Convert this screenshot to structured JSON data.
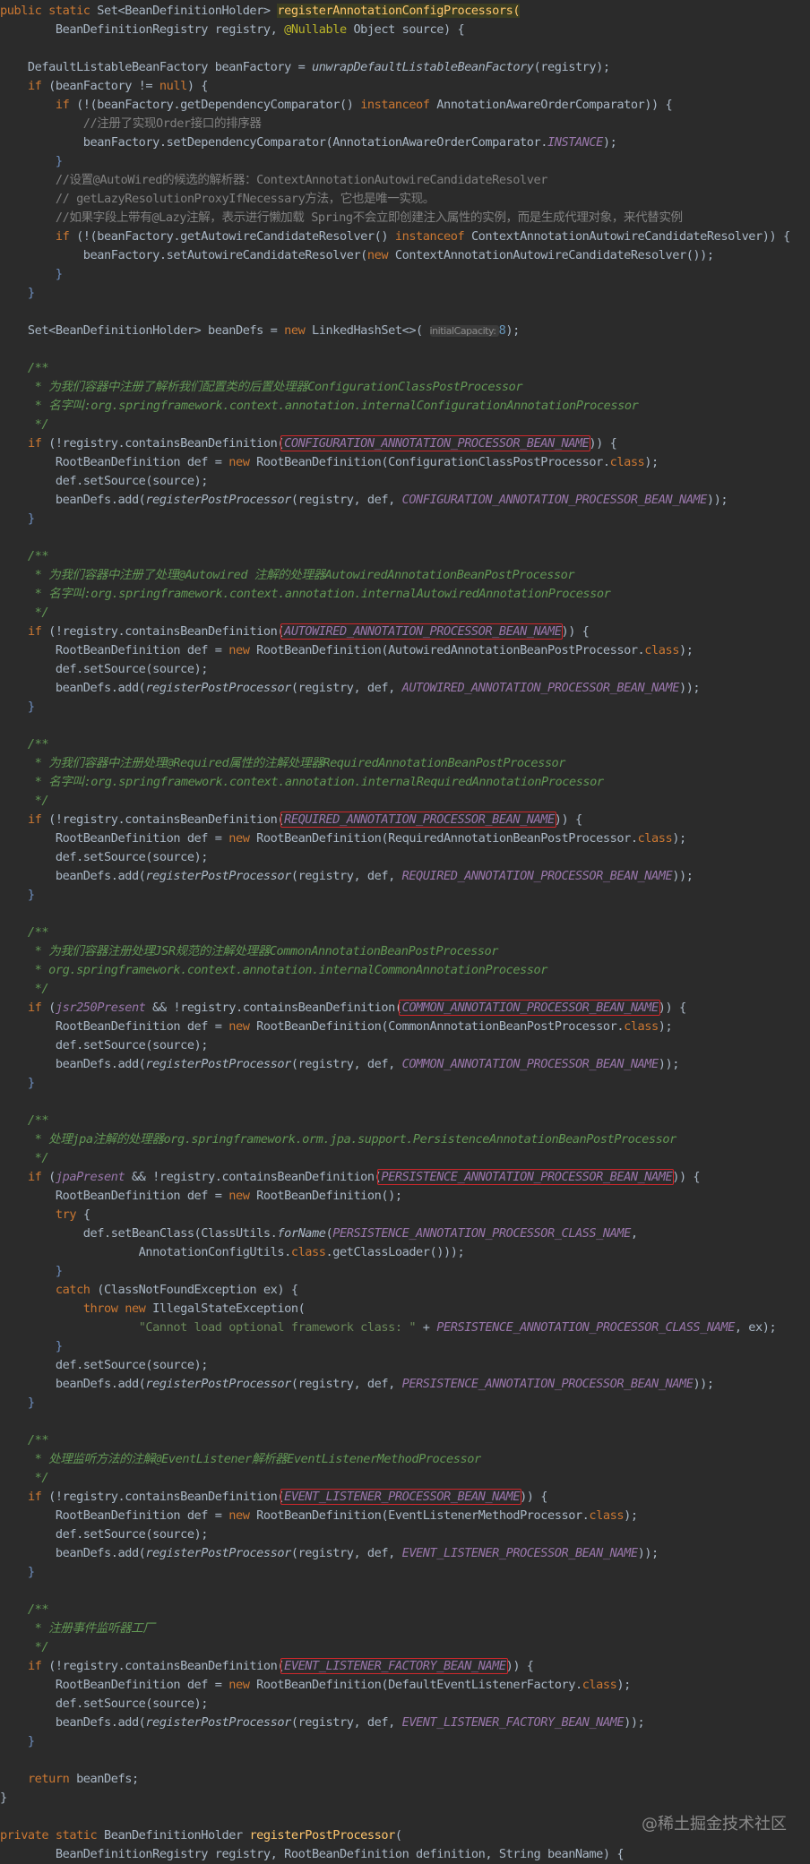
{
  "theme": {
    "bg": "#2b2b2b",
    "text": "#a9b7c6",
    "keyword": "#cc7832",
    "method": "#ffc66d",
    "call": "#a9b7c6",
    "comment": "#808080",
    "doc": "#629755",
    "constant": "#9876aa",
    "number": "#6897bb",
    "string": "#6a8759",
    "annotation": "#bbb529",
    "brace": "#6e8fc0",
    "hint": "#8c8c8c",
    "hint_bg": "#3b3b3b",
    "box": "#d0282c",
    "method_hl_bg": "#3b3d22"
  },
  "code_lines": [
    [
      [
        "public static ",
        "kw"
      ],
      [
        "Set<BeanDefinitionHolder> ",
        "tx"
      ],
      [
        "registerAnnotationConfigProcessors(",
        "mh"
      ]
    ],
    [
      [
        "        BeanDefinitionRegistry registry, ",
        "tx"
      ],
      [
        "@Nullable ",
        "an"
      ],
      [
        "Object source) {",
        "tx"
      ]
    ],
    [],
    [
      [
        "    DefaultListableBeanFactory beanFactory = ",
        "tx"
      ],
      [
        "unwrapDefaultListableBeanFactory",
        "it"
      ],
      [
        "(registry);",
        "tx"
      ]
    ],
    [
      [
        "    ",
        "tx"
      ],
      [
        "if ",
        "kw"
      ],
      [
        "(beanFactory != ",
        "tx"
      ],
      [
        "null",
        "kw"
      ],
      [
        ") {",
        "tx"
      ]
    ],
    [
      [
        "        ",
        "tx"
      ],
      [
        "if ",
        "kw"
      ],
      [
        "(!(beanFactory.getDependencyComparator() ",
        "tx"
      ],
      [
        "instanceof ",
        "kw"
      ],
      [
        "AnnotationAwareOrderComparator)) {",
        "tx"
      ]
    ],
    [
      [
        "            //注册了实现Order接口的排序器",
        "cm"
      ]
    ],
    [
      [
        "            beanFactory.setDependencyComparator(AnnotationAwareOrderComparator.",
        "tx"
      ],
      [
        "INSTANCE",
        "co"
      ],
      [
        ");",
        "tx"
      ]
    ],
    [
      [
        "        }",
        "br"
      ]
    ],
    [
      [
        "        //设置@AutoWired的候选的解析器：ContextAnnotationAutowireCandidateResolver",
        "cm"
      ]
    ],
    [
      [
        "        // getLazyResolutionProxyIfNecessary方法，它也是唯一实现。",
        "cm"
      ]
    ],
    [
      [
        "        //如果字段上带有@Lazy注解，表示进行懒加载 Spring不会立即创建注入属性的实例，而是生成代理对象，来代替实例",
        "cm"
      ]
    ],
    [
      [
        "        ",
        "tx"
      ],
      [
        "if ",
        "kw"
      ],
      [
        "(!(beanFactory.getAutowireCandidateResolver() ",
        "tx"
      ],
      [
        "instanceof ",
        "kw"
      ],
      [
        "ContextAnnotationAutowireCandidateResolver)) {",
        "tx"
      ]
    ],
    [
      [
        "            beanFactory.setAutowireCandidateResolver(",
        "tx"
      ],
      [
        "new ",
        "kw"
      ],
      [
        "ContextAnnotationAutowireCandidateResolver());",
        "tx"
      ]
    ],
    [
      [
        "        }",
        "br"
      ]
    ],
    [
      [
        "    }",
        "br"
      ]
    ],
    [],
    [
      [
        "    Set<BeanDefinitionHolder> beanDefs = ",
        "tx"
      ],
      [
        "new ",
        "kw"
      ],
      [
        "LinkedHashSet<>( ",
        "tx"
      ],
      [
        "initialCapacity: ",
        "hint"
      ],
      [
        "8",
        "nm"
      ],
      [
        ");",
        "tx"
      ]
    ],
    [],
    [
      [
        "    /**",
        "dc"
      ]
    ],
    [
      [
        "     * 为我们容器中注册了解析我们配置类的后置处理器ConfigurationClassPostProcessor",
        "dc"
      ]
    ],
    [
      [
        "     * 名字叫:org.springframework.context.annotation.internalConfigurationAnnotationProcessor",
        "dc"
      ]
    ],
    [
      [
        "     */",
        "dc"
      ]
    ],
    [
      [
        "    ",
        "tx"
      ],
      [
        "if ",
        "kw"
      ],
      [
        "(!registry.containsBeanDefinition(",
        "tx"
      ],
      [
        "CONFIGURATION_ANNOTATION_PROCESSOR_BEAN_NAME",
        "co"
      ],
      [
        ")) {",
        "tx"
      ]
    ],
    [
      [
        "        RootBeanDefinition def = ",
        "tx"
      ],
      [
        "new ",
        "kw"
      ],
      [
        "RootBeanDefinition(ConfigurationClassPostProcessor.",
        "tx"
      ],
      [
        "class",
        "kw"
      ],
      [
        ");",
        "tx"
      ]
    ],
    [
      [
        "        def.setSource(source);",
        "tx"
      ]
    ],
    [
      [
        "        beanDefs.add(",
        "tx"
      ],
      [
        "registerPostProcessor",
        "it"
      ],
      [
        "(registry, def, ",
        "tx"
      ],
      [
        "CONFIGURATION_ANNOTATION_PROCESSOR_BEAN_NAME",
        "co"
      ],
      [
        "));",
        "tx"
      ]
    ],
    [
      [
        "    }",
        "br"
      ]
    ],
    [],
    [
      [
        "    /**",
        "dc"
      ]
    ],
    [
      [
        "     * 为我们容器中注册了处理@Autowired 注解的处理器AutowiredAnnotationBeanPostProcessor",
        "dc"
      ]
    ],
    [
      [
        "     * 名字叫:org.springframework.context.annotation.internalAutowiredAnnotationProcessor",
        "dc"
      ]
    ],
    [
      [
        "     */",
        "dc"
      ]
    ],
    [
      [
        "    ",
        "tx"
      ],
      [
        "if ",
        "kw"
      ],
      [
        "(!registry.containsBeanDefinition(",
        "tx"
      ],
      [
        "AUTOWIRED_ANNOTATION_PROCESSOR_BEAN_NAME",
        "co"
      ],
      [
        ")) {",
        "tx"
      ]
    ],
    [
      [
        "        RootBeanDefinition def = ",
        "tx"
      ],
      [
        "new ",
        "kw"
      ],
      [
        "RootBeanDefinition(AutowiredAnnotationBeanPostProcessor.",
        "tx"
      ],
      [
        "class",
        "kw"
      ],
      [
        ");",
        "tx"
      ]
    ],
    [
      [
        "        def.setSource(source);",
        "tx"
      ]
    ],
    [
      [
        "        beanDefs.add(",
        "tx"
      ],
      [
        "registerPostProcessor",
        "it"
      ],
      [
        "(registry, def, ",
        "tx"
      ],
      [
        "AUTOWIRED_ANNOTATION_PROCESSOR_BEAN_NAME",
        "co"
      ],
      [
        "));",
        "tx"
      ]
    ],
    [
      [
        "    }",
        "br"
      ]
    ],
    [],
    [
      [
        "    /**",
        "dc"
      ]
    ],
    [
      [
        "     * 为我们容器中注册处理@Required属性的注解处理器RequiredAnnotationBeanPostProcessor",
        "dc"
      ]
    ],
    [
      [
        "     * 名字叫:org.springframework.context.annotation.internalRequiredAnnotationProcessor",
        "dc"
      ]
    ],
    [
      [
        "     */",
        "dc"
      ]
    ],
    [
      [
        "    ",
        "tx"
      ],
      [
        "if ",
        "kw"
      ],
      [
        "(!registry.containsBeanDefinition(",
        "tx"
      ],
      [
        "REQUIRED_ANNOTATION_PROCESSOR_BEAN_NAME",
        "co"
      ],
      [
        ")) {",
        "tx"
      ]
    ],
    [
      [
        "        RootBeanDefinition def = ",
        "tx"
      ],
      [
        "new ",
        "kw"
      ],
      [
        "RootBeanDefinition(RequiredAnnotationBeanPostProcessor.",
        "tx"
      ],
      [
        "class",
        "kw"
      ],
      [
        ");",
        "tx"
      ]
    ],
    [
      [
        "        def.setSource(source);",
        "tx"
      ]
    ],
    [
      [
        "        beanDefs.add(",
        "tx"
      ],
      [
        "registerPostProcessor",
        "it"
      ],
      [
        "(registry, def, ",
        "tx"
      ],
      [
        "REQUIRED_ANNOTATION_PROCESSOR_BEAN_NAME",
        "co"
      ],
      [
        "));",
        "tx"
      ]
    ],
    [
      [
        "    }",
        "br"
      ]
    ],
    [],
    [
      [
        "    /**",
        "dc"
      ]
    ],
    [
      [
        "     * 为我们容器注册处理JSR规范的注解处理器CommonAnnotationBeanPostProcessor",
        "dc"
      ]
    ],
    [
      [
        "     * org.springframework.context.annotation.internalCommonAnnotationProcessor",
        "dc"
      ]
    ],
    [
      [
        "     */",
        "dc"
      ]
    ],
    [
      [
        "    ",
        "tx"
      ],
      [
        "if ",
        "kw"
      ],
      [
        "(",
        "tx"
      ],
      [
        "jsr250Present ",
        "co"
      ],
      [
        "&& !registry.containsBeanDefinition(",
        "tx"
      ],
      [
        "COMMON_ANNOTATION_PROCESSOR_BEAN_NAME",
        "co"
      ],
      [
        ")) {",
        "tx"
      ]
    ],
    [
      [
        "        RootBeanDefinition def = ",
        "tx"
      ],
      [
        "new ",
        "kw"
      ],
      [
        "RootBeanDefinition(CommonAnnotationBeanPostProcessor.",
        "tx"
      ],
      [
        "class",
        "kw"
      ],
      [
        ");",
        "tx"
      ]
    ],
    [
      [
        "        def.setSource(source);",
        "tx"
      ]
    ],
    [
      [
        "        beanDefs.add(",
        "tx"
      ],
      [
        "registerPostProcessor",
        "it"
      ],
      [
        "(registry, def, ",
        "tx"
      ],
      [
        "COMMON_ANNOTATION_PROCESSOR_BEAN_NAME",
        "co"
      ],
      [
        "));",
        "tx"
      ]
    ],
    [
      [
        "    }",
        "br"
      ]
    ],
    [],
    [
      [
        "    /**",
        "dc"
      ]
    ],
    [
      [
        "     * 处理jpa注解的处理器org.springframework.orm.jpa.support.PersistenceAnnotationBeanPostProcessor",
        "dc"
      ]
    ],
    [
      [
        "     */",
        "dc"
      ]
    ],
    [
      [
        "    ",
        "tx"
      ],
      [
        "if ",
        "kw"
      ],
      [
        "(",
        "tx"
      ],
      [
        "jpaPresent ",
        "co"
      ],
      [
        "&& !registry.containsBeanDefinition(",
        "tx"
      ],
      [
        "PERSISTENCE_ANNOTATION_PROCESSOR_BEAN_NAME",
        "co"
      ],
      [
        ")) {",
        "tx"
      ]
    ],
    [
      [
        "        RootBeanDefinition def = ",
        "tx"
      ],
      [
        "new ",
        "kw"
      ],
      [
        "RootBeanDefinition();",
        "tx"
      ]
    ],
    [
      [
        "        ",
        "tx"
      ],
      [
        "try ",
        "kw"
      ],
      [
        "{",
        "tx"
      ]
    ],
    [
      [
        "            def.setBeanClass(ClassUtils.",
        "tx"
      ],
      [
        "forName",
        "it"
      ],
      [
        "(",
        "tx"
      ],
      [
        "PERSISTENCE_ANNOTATION_PROCESSOR_CLASS_NAME",
        "co"
      ],
      [
        ",",
        "tx"
      ]
    ],
    [
      [
        "                    AnnotationConfigUtils.",
        "tx"
      ],
      [
        "class",
        "kw"
      ],
      [
        ".getClassLoader()));",
        "tx"
      ]
    ],
    [
      [
        "        }",
        "br"
      ]
    ],
    [
      [
        "        ",
        "tx"
      ],
      [
        "catch ",
        "kw"
      ],
      [
        "(ClassNotFoundException ex) {",
        "tx"
      ]
    ],
    [
      [
        "            ",
        "tx"
      ],
      [
        "throw new ",
        "kw"
      ],
      [
        "IllegalStateException(",
        "tx"
      ]
    ],
    [
      [
        "                    ",
        "tx"
      ],
      [
        "\"Cannot load optional framework class: \" ",
        "st"
      ],
      [
        "+ ",
        "tx"
      ],
      [
        "PERSISTENCE_ANNOTATION_PROCESSOR_CLASS_NAME",
        "co"
      ],
      [
        ", ex);",
        "tx"
      ]
    ],
    [
      [
        "        }",
        "br"
      ]
    ],
    [
      [
        "        def.setSource(source);",
        "tx"
      ]
    ],
    [
      [
        "        beanDefs.add(",
        "tx"
      ],
      [
        "registerPostProcessor",
        "it"
      ],
      [
        "(registry, def, ",
        "tx"
      ],
      [
        "PERSISTENCE_ANNOTATION_PROCESSOR_BEAN_NAME",
        "co"
      ],
      [
        "));",
        "tx"
      ]
    ],
    [
      [
        "    }",
        "br"
      ]
    ],
    [],
    [
      [
        "    /**",
        "dc"
      ]
    ],
    [
      [
        "     * 处理监听方法的注解@EventListener解析器EventListenerMethodProcessor",
        "dc"
      ]
    ],
    [
      [
        "     */",
        "dc"
      ]
    ],
    [
      [
        "    ",
        "tx"
      ],
      [
        "if ",
        "kw"
      ],
      [
        "(!registry.containsBeanDefinition(",
        "tx"
      ],
      [
        "EVENT_LISTENER_PROCESSOR_BEAN_NAME",
        "co"
      ],
      [
        ")) {",
        "tx"
      ]
    ],
    [
      [
        "        RootBeanDefinition def = ",
        "tx"
      ],
      [
        "new ",
        "kw"
      ],
      [
        "RootBeanDefinition(EventListenerMethodProcessor.",
        "tx"
      ],
      [
        "class",
        "kw"
      ],
      [
        ");",
        "tx"
      ]
    ],
    [
      [
        "        def.setSource(source);",
        "tx"
      ]
    ],
    [
      [
        "        beanDefs.add(",
        "tx"
      ],
      [
        "registerPostProcessor",
        "it"
      ],
      [
        "(registry, def, ",
        "tx"
      ],
      [
        "EVENT_LISTENER_PROCESSOR_BEAN_NAME",
        "co"
      ],
      [
        "));",
        "tx"
      ]
    ],
    [
      [
        "    }",
        "br"
      ]
    ],
    [],
    [
      [
        "    /**",
        "dc"
      ]
    ],
    [
      [
        "     * 注册事件监听器工厂",
        "dc"
      ]
    ],
    [
      [
        "     */",
        "dc"
      ]
    ],
    [
      [
        "    ",
        "tx"
      ],
      [
        "if ",
        "kw"
      ],
      [
        "(!registry.containsBeanDefinition(",
        "tx"
      ],
      [
        "EVENT_LISTENER_FACTORY_BEAN_NAME",
        "co"
      ],
      [
        ")) {",
        "tx"
      ]
    ],
    [
      [
        "        RootBeanDefinition def = ",
        "tx"
      ],
      [
        "new ",
        "kw"
      ],
      [
        "RootBeanDefinition(DefaultEventListenerFactory.",
        "tx"
      ],
      [
        "class",
        "kw"
      ],
      [
        ");",
        "tx"
      ]
    ],
    [
      [
        "        def.setSource(source);",
        "tx"
      ]
    ],
    [
      [
        "        beanDefs.add(",
        "tx"
      ],
      [
        "registerPostProcessor",
        "it"
      ],
      [
        "(registry, def, ",
        "tx"
      ],
      [
        "EVENT_LISTENER_FACTORY_BEAN_NAME",
        "co"
      ],
      [
        "));",
        "tx"
      ]
    ],
    [
      [
        "    }",
        "br"
      ]
    ],
    [],
    [
      [
        "    ",
        "tx"
      ],
      [
        "return ",
        "kw"
      ],
      [
        "beanDefs;",
        "tx"
      ]
    ],
    [
      [
        "}",
        "tx"
      ]
    ],
    [],
    [
      [
        "private static ",
        "kw"
      ],
      [
        "BeanDefinitionHolder ",
        "tx"
      ],
      [
        "registerPostProcessor",
        "mt"
      ],
      [
        "(",
        "tx"
      ]
    ],
    [
      [
        "        BeanDefinitionRegistry registry, RootBeanDefinition definition, String beanName) {",
        "tx"
      ]
    ]
  ],
  "boxed_constants": [
    "CONFIGURATION_ANNOTATION_PROCESSOR_BEAN_NAME",
    "AUTOWIRED_ANNOTATION_PROCESSOR_BEAN_NAME",
    "REQUIRED_ANNOTATION_PROCESSOR_BEAN_NAME",
    "COMMON_ANNOTATION_PROCESSOR_BEAN_NAME",
    "PERSISTENCE_ANNOTATION_PROCESSOR_BEAN_NAME",
    "EVENT_LISTENER_PROCESSOR_BEAN_NAME",
    "EVENT_LISTENER_FACTORY_BEAN_NAME"
  ],
  "watermark": "@稀土掘金技术社区"
}
